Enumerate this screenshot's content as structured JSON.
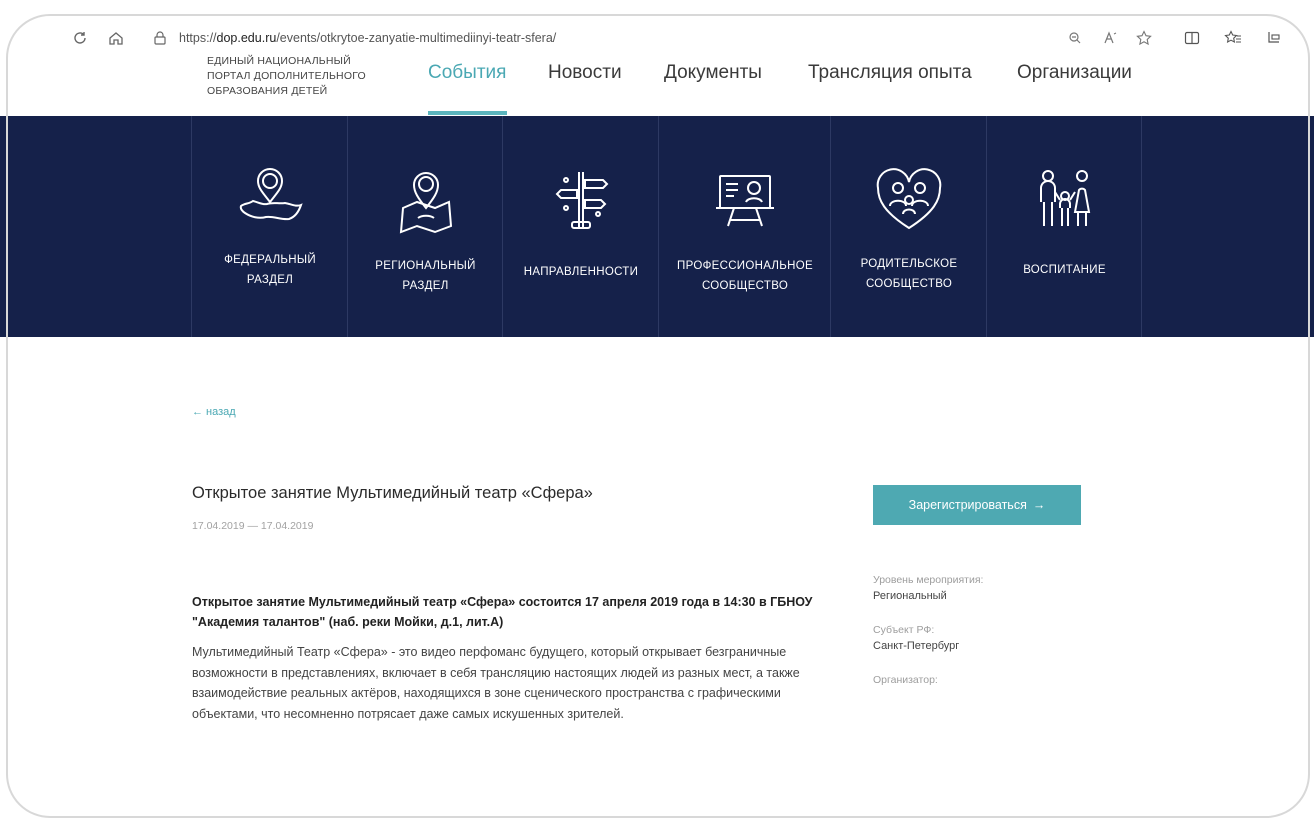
{
  "browser": {
    "url_prefix": "https://",
    "url_domain": "dop.edu.ru",
    "url_path": "/events/otkrytoe-zanyatie-multimediinyi-teatr-sfera/",
    "icons": [
      "reload-icon",
      "home-icon",
      "lock-icon",
      "zoom-icon",
      "read-aloud-icon",
      "favorite-icon",
      "split-screen-icon",
      "favorites-list-icon",
      "collections-icon"
    ]
  },
  "header": {
    "logo_lines": [
      "ЕДИНЫЙ НАЦИОНАЛЬНЫЙ",
      "ПОРТАЛ ДОПОЛНИТЕЛЬНОГО",
      "ОБРАЗОВАНИЯ ДЕТЕЙ"
    ],
    "nav": [
      {
        "label": "События",
        "active": true
      },
      {
        "label": "Новости",
        "active": false
      },
      {
        "label": "Документы",
        "active": false
      },
      {
        "label": "Трансляция опыта",
        "active": false
      },
      {
        "label": "Организации",
        "active": false
      }
    ],
    "accent_color": "#4aa8b3"
  },
  "categories": [
    {
      "line1": "ФЕДЕРАЛЬНЫЙ",
      "line2": "РАЗДЕЛ",
      "icon": "russia-map-pin-icon"
    },
    {
      "line1": "РЕГИОНАЛЬНЫЙ",
      "line2": "РАЗДЕЛ",
      "icon": "region-map-pin-icon"
    },
    {
      "line1": "НАПРАВЛЕННОСТИ",
      "line2": "",
      "icon": "signpost-icon"
    },
    {
      "line1": "ПРОФЕССИОНАЛЬНОЕ",
      "line2": "СООБЩЕСТВО",
      "icon": "presentation-board-icon"
    },
    {
      "line1": "РОДИТЕЛЬСКОЕ",
      "line2": "СООБЩЕСТВО",
      "icon": "family-heart-icon"
    },
    {
      "line1": "ВОСПИТАНИЕ",
      "line2": "",
      "icon": "family-icon"
    }
  ],
  "band_color": "#15214a",
  "event": {
    "back_label": "← назад",
    "title": "Открытое занятие Мультимедийный театр «Сфера»",
    "dates": "17.04.2019 — 17.04.2019",
    "register_label": "Зарегистрироваться",
    "register_arrow": "→",
    "lead": "Открытое занятие Мультимедийный театр «Сфера» состоится 17 апреля 2019 года в 14:30 в ГБНОУ \"Академия талантов\" (наб. реки Мойки, д.1, лит.А)",
    "body": "Мультимедийный Театр «Сфера» - это видео перфоманс будущего, который открывает безграничные возможности в представлениях, включает в себя трансляцию настоящих людей из разных мест, а также взаимодействие реальных актёров, находящихся в зоне сценического пространства с графическими объектами, что несомненно потрясает даже самых искушенных зрителей."
  },
  "meta": {
    "level_label": "Уровень мероприятия:",
    "level_value": "Региональный",
    "subject_label": "Субъект РФ:",
    "subject_value": "Санкт-Петербург",
    "organizer_label": "Организатор:"
  }
}
